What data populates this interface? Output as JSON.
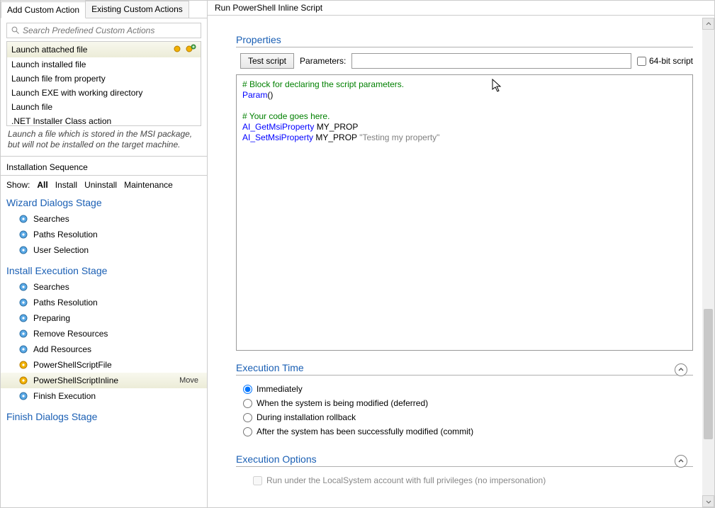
{
  "tabs": {
    "add": "Add Custom Action",
    "existing": "Existing Custom Actions"
  },
  "search": {
    "placeholder": "Search Predefined Custom Actions"
  },
  "action_list": [
    "Launch attached file",
    "Launch installed file",
    "Launch file from property",
    "Launch EXE with working directory",
    "Launch file",
    ".NET Installer Class action"
  ],
  "hint": "Launch a file which is stored in the MSI package, but will not be installed on the target machine.",
  "seq_title": "Installation Sequence",
  "show": {
    "label": "Show:",
    "all": "All",
    "install": "Install",
    "uninstall": "Uninstall",
    "maint": "Maintenance"
  },
  "stages": {
    "wizard": {
      "title": "Wizard Dialogs Stage",
      "items": [
        "Searches",
        "Paths Resolution",
        "User Selection"
      ]
    },
    "install": {
      "title": "Install Execution Stage",
      "items": [
        "Searches",
        "Paths Resolution",
        "Preparing",
        "Remove Resources",
        "Add Resources",
        "PowerShellScriptFile",
        "PowerShellScriptInline",
        "Finish Execution"
      ],
      "selected_index": 6,
      "move_label": "Move"
    },
    "finish": {
      "title": "Finish Dialogs Stage"
    }
  },
  "right": {
    "title": "Run PowerShell Inline Script",
    "properties": {
      "header": "Properties",
      "test_btn": "Test script",
      "params_label": "Parameters:",
      "bit64": "64-bit script"
    },
    "code": {
      "l1_comment": "# Block for declaring the script parameters.",
      "l2_kw": "Param",
      "l2_paren": "()",
      "l3_blank": " ",
      "l4_comment": "# Your code goes here.",
      "l5_fn": "AI_GetMsiProperty",
      "l5_arg": " MY_PROP",
      "l6_fn": "AI_SetMsiProperty",
      "l6_arg": " MY_PROP ",
      "l6_str": "\"Testing my property\""
    },
    "exec_time": {
      "header": "Execution Time",
      "opts": [
        "Immediately",
        "When the system is being modified (deferred)",
        "During installation rollback",
        "After the system has been successfully modified (commit)"
      ],
      "selected": 0
    },
    "exec_opts": {
      "header": "Execution Options",
      "item": "Run under the LocalSystem account with full privileges (no impersonation)"
    }
  }
}
